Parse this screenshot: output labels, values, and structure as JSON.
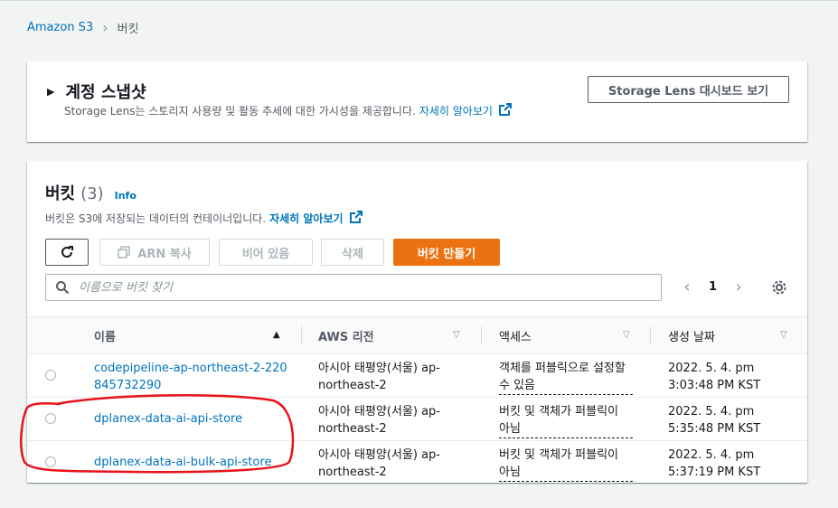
{
  "breadcrumb": {
    "root": "Amazon S3",
    "current": "버킷"
  },
  "snapshot": {
    "title": "계정 스냅샷",
    "description": "Storage Lens는 스토리지 사용량 및 활동 추세에 대한 가시성을 제공합니다.",
    "learn_more": "자세히 알아보기",
    "dashboard_button": "Storage Lens 대시보드 보기"
  },
  "buckets": {
    "title": "버킷",
    "count": "(3)",
    "info": "Info",
    "description": "버킷은 S3에 저장되는 데이터의 컨테이너입니다.",
    "learn_more": "자세히 알아보기",
    "actions": {
      "copy_arn": "ARN 복사",
      "empty": "비어 있음",
      "delete": "삭제",
      "create": "버킷 만들기"
    },
    "search_placeholder": "이름으로 버킷 찾기",
    "page": "1"
  },
  "table": {
    "columns": {
      "name": "이름",
      "region": "AWS 리전",
      "access": "액세스",
      "created": "생성 날짜"
    },
    "rows": [
      {
        "name": "codepipeline-ap-northeast-2-220845732290",
        "region": "아시아 태평양(서울) ap-northeast-2",
        "access": "객체를 퍼블릭으로 설정할 수 있음",
        "created": "2022. 5. 4. pm 3:03:48 PM KST"
      },
      {
        "name": "dplanex-data-ai-api-store",
        "region": "아시아 태평양(서울) ap-northeast-2",
        "access": "버킷 및 객체가 퍼블릭이 아님",
        "created": "2022. 5. 4. pm 5:35:48 PM KST"
      },
      {
        "name": "dplanex-data-ai-bulk-api-store",
        "region": "아시아 태평양(서울) ap-northeast-2",
        "access": "버킷 및 객체가 퍼블릭이 아님",
        "created": "2022. 5. 4. pm 5:37:19 PM KST"
      }
    ]
  },
  "colors": {
    "link": "#0073bb",
    "primary": "#ec7211",
    "annotation": "#e8131b"
  }
}
